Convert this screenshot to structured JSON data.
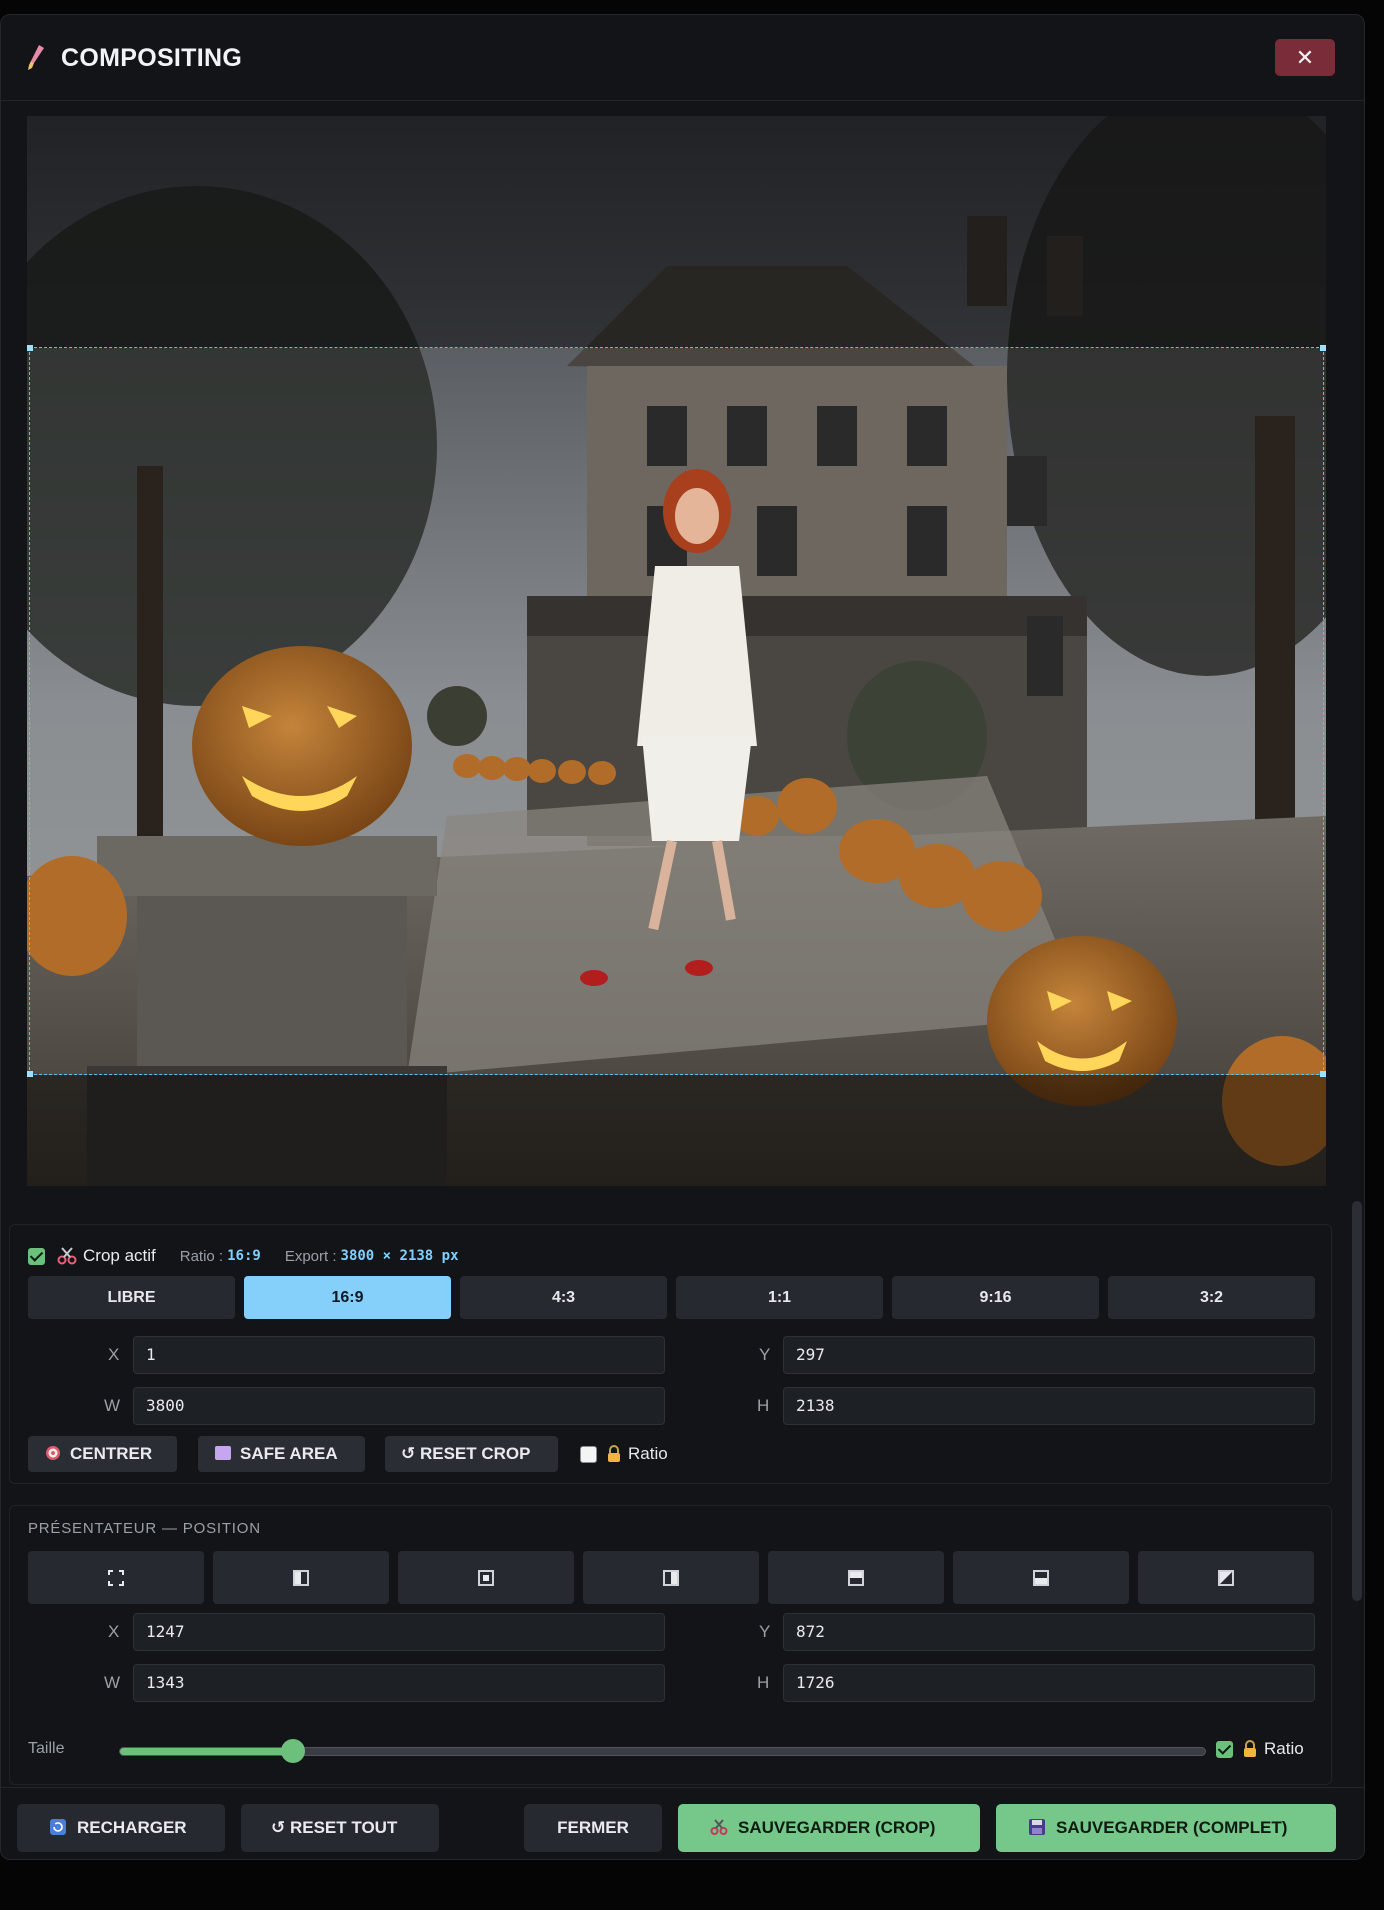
{
  "header": {
    "title": "COMPOSITING",
    "close_label": "✕"
  },
  "crop": {
    "active_label": "Crop actif",
    "active_checked": true,
    "ratio_key": "Ratio :",
    "ratio_value": "16:9",
    "export_key": "Export :",
    "export_value": "3800 × 2138 px",
    "ratios": [
      "LIBRE",
      "16:9",
      "4:3",
      "1:1",
      "9:16",
      "3:2"
    ],
    "selected_ratio": "16:9",
    "fields": {
      "x_label": "X",
      "x": "1",
      "y_label": "Y",
      "y": "297",
      "w_label": "W",
      "w": "3800",
      "h_label": "H",
      "h": "2138"
    },
    "center_label": "CENTRER",
    "safe_area_label": "SAFE AREA",
    "reset_crop_label": "↺ RESET CROP",
    "ratio_lock_label": "Ratio",
    "ratio_lock_checked": false
  },
  "presenter": {
    "section_title": "PRÉSENTATEUR — POSITION",
    "position_icons": [
      "fullscreen-icon",
      "align-left-icon",
      "align-center-icon",
      "align-right-icon",
      "align-top-icon",
      "align-bottom-icon",
      "corner-icon"
    ],
    "fields": {
      "x_label": "X",
      "x": "1247",
      "y_label": "Y",
      "y": "872",
      "w_label": "W",
      "w": "1343",
      "h_label": "H",
      "h": "1726"
    },
    "size_label": "Taille",
    "size_fraction": 0.16,
    "ratio_lock_label": "Ratio",
    "ratio_lock_checked": true
  },
  "footer": {
    "reload_label": "RECHARGER",
    "reset_all_label": "↺ RESET TOUT",
    "close_label": "FERMER",
    "save_crop_label": "SAUVEGARDER (CROP)",
    "save_full_label": "SAUVEGARDER (COMPLET)"
  },
  "colors": {
    "accent_blue": "#85d0fb",
    "green": "#75c88a",
    "danger": "#7a2d39",
    "bg": "#121418"
  }
}
